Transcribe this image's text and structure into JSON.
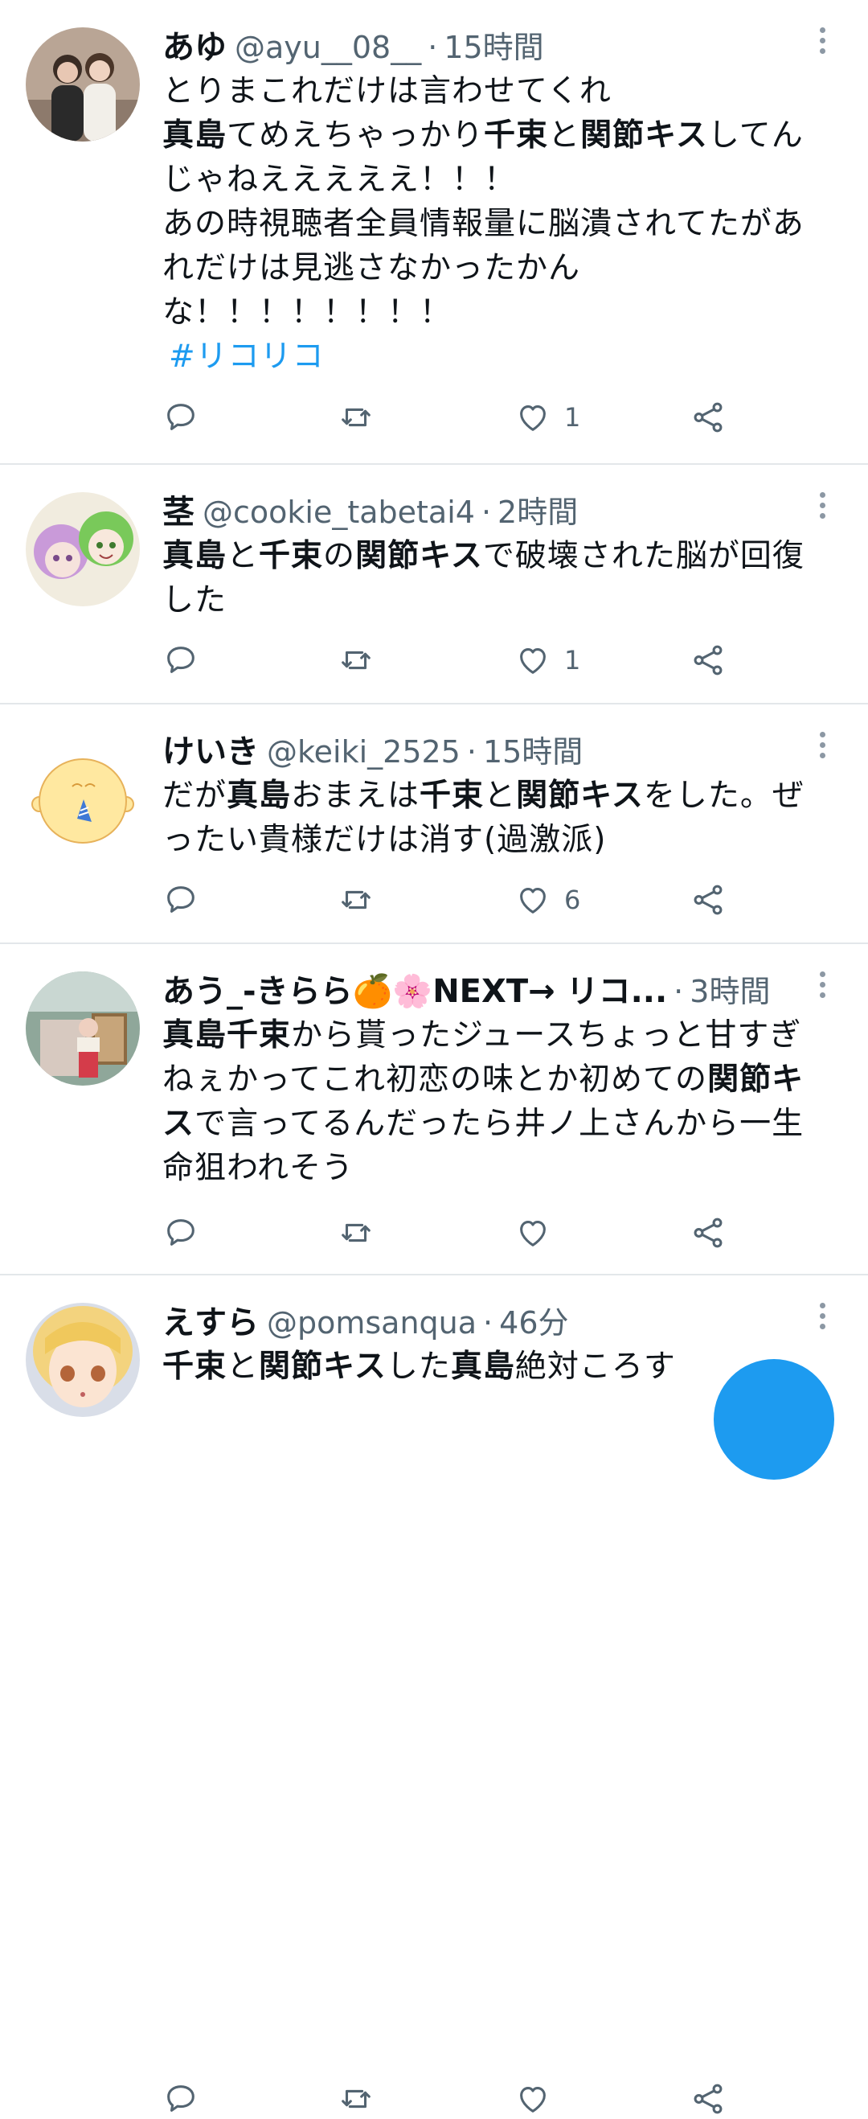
{
  "tweets": [
    {
      "name": "あゆ",
      "handle": "@ayu__08__",
      "time": "15時間",
      "lines": [
        [
          {
            "t": "とりまこれだけは言わせてくれ"
          }
        ],
        [
          {
            "t": "真島",
            "b": true
          },
          {
            "t": "てめえちゃっかり"
          },
          {
            "t": "千束",
            "b": true
          },
          {
            "t": "と"
          },
          {
            "t": "関節キス",
            "b": true
          },
          {
            "t": "してん"
          }
        ],
        [
          {
            "t": "じゃねえええええ！！！"
          }
        ],
        [
          {
            "t": "あの時視聴者全員情報量に脳潰されてたがあ"
          }
        ],
        [
          {
            "t": "れだけは見逃さなかったかん"
          }
        ],
        [
          {
            "t": "な！！！！！！！！"
          }
        ]
      ],
      "hashtag": "#リコリコ",
      "likes": "1"
    },
    {
      "name": "茎",
      "handle": "@cookie_tabetai4",
      "time": "2時間",
      "lines": [
        [
          {
            "t": "真島",
            "b": true
          },
          {
            "t": "と"
          },
          {
            "t": "千束",
            "b": true
          },
          {
            "t": "の"
          },
          {
            "t": "関節キス",
            "b": true
          },
          {
            "t": "で破壊された脳が回復"
          }
        ],
        [
          {
            "t": "した"
          }
        ]
      ],
      "likes": "1"
    },
    {
      "name": "けいき",
      "handle": "@keiki_2525",
      "time": "15時間",
      "lines": [
        [
          {
            "t": "だが"
          },
          {
            "t": "真島",
            "b": true
          },
          {
            "t": "おまえは"
          },
          {
            "t": "千束",
            "b": true
          },
          {
            "t": "と"
          },
          {
            "t": "関節キス",
            "b": true
          },
          {
            "t": "をした。ぜ"
          }
        ],
        [
          {
            "t": "ったい貴様だけは消す(過激派)"
          }
        ]
      ],
      "likes": "6"
    },
    {
      "name": "あう_-きらら🍊🌸NEXT→ リコ...",
      "handle": "",
      "time": "3時間",
      "lines": [
        [
          {
            "t": "真島千束",
            "b": true
          },
          {
            "t": "から貰ったジュースちょっと甘すぎ"
          }
        ],
        [
          {
            "t": "ねぇかってこれ初恋の味とか初めての"
          },
          {
            "t": "関節キ",
            "b": true
          }
        ],
        [
          {
            "t": "ス",
            "b": true
          },
          {
            "t": "で言ってるんだったら井ノ上さんから一生"
          }
        ],
        [
          {
            "t": "命狙われそう"
          }
        ]
      ],
      "likes": ""
    },
    {
      "name": "えすら",
      "handle": "@pomsanqua",
      "time": "46分",
      "lines": [
        [
          {
            "t": "千束",
            "b": true
          },
          {
            "t": "と"
          },
          {
            "t": "関節キス",
            "b": true
          },
          {
            "t": "した"
          },
          {
            "t": "真島",
            "b": true
          },
          {
            "t": "絶対ころす"
          }
        ]
      ],
      "likes": ""
    }
  ],
  "icons": {
    "reply": "reply-icon",
    "retweet": "retweet-icon",
    "like": "heart-icon",
    "share": "share-icon",
    "more": "more-options-icon"
  },
  "colors": {
    "text": "#0f1419",
    "secondary": "#536471",
    "accent": "#1d9bf0",
    "divider": "#e3e7ea"
  }
}
